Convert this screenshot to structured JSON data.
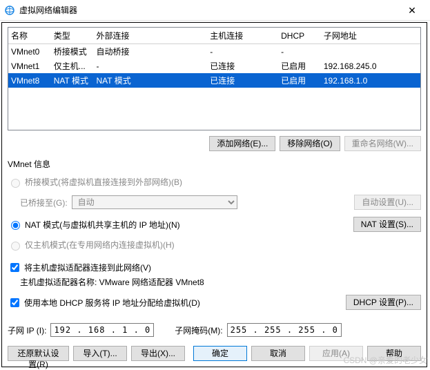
{
  "window": {
    "title": "虚拟网络编辑器",
    "close_glyph": "✕"
  },
  "grid": {
    "headers": [
      "名称",
      "类型",
      "外部连接",
      "主机连接",
      "DHCP",
      "子网地址"
    ],
    "col_widths": [
      "60",
      "60",
      "160",
      "100",
      "60",
      "140"
    ],
    "rows": [
      {
        "cells": [
          "VMnet0",
          "桥接模式",
          "自动桥接",
          "-",
          "-",
          ""
        ],
        "selected": false
      },
      {
        "cells": [
          "VMnet1",
          "仅主机...",
          "-",
          "已连接",
          "已启用",
          "192.168.245.0"
        ],
        "selected": false
      },
      {
        "cells": [
          "VMnet8",
          "NAT 模式",
          "NAT 模式",
          "已连接",
          "已启用",
          "192.168.1.0"
        ],
        "selected": true
      }
    ]
  },
  "row_buttons": {
    "add": "添加网络(E)...",
    "remove": "移除网络(O)",
    "rename": "重命名网络(W)..."
  },
  "info_label": "VMnet 信息",
  "mode": {
    "bridge_label": "桥接模式(将虚拟机直接连接到外部网络)(B)",
    "bridge_to_label": "已桥接至(G):",
    "bridge_options": [
      "自动"
    ],
    "bridge_auto_btn": "自动设置(U)...",
    "nat_label": "NAT 模式(与虚拟机共享主机的 IP 地址)(N)",
    "nat_btn": "NAT 设置(S)...",
    "host_only_label": "仅主机模式(在专用网络内连接虚拟机)(H)"
  },
  "host_adapter": {
    "checkbox_label": "将主机虚拟适配器连接到此网络(V)",
    "name_line": "主机虚拟适配器名称: VMware 网络适配器 VMnet8"
  },
  "dhcp": {
    "checkbox_label": "使用本地 DHCP 服务将 IP 地址分配给虚拟机(D)",
    "btn": "DHCP 设置(P)..."
  },
  "subnet": {
    "ip_label": "子网 IP (I):",
    "ip_value": "192 . 168 .  1  .  0",
    "mask_label": "子网掩码(M):",
    "mask_value": "255 . 255 . 255 .  0"
  },
  "footer": {
    "restore": "还原默认设置(R)",
    "import": "导入(T)...",
    "export": "导出(X)...",
    "ok": "确定",
    "cancel": "取消",
    "apply": "应用(A)",
    "help": "帮助"
  },
  "watermark": "CSDN @亲爱的老少女"
}
